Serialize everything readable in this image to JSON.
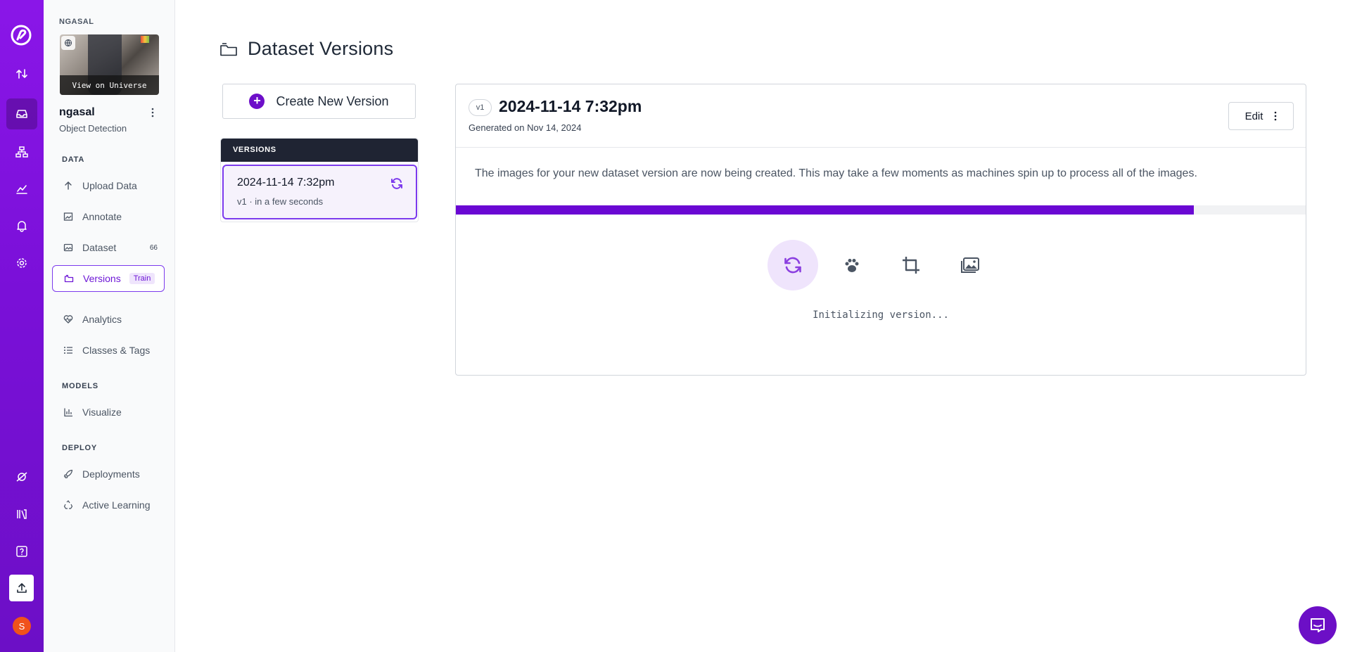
{
  "workspace": {
    "name": "NGASAL",
    "view_universe": "View on Universe"
  },
  "project": {
    "name": "ngasal",
    "type": "Object Detection"
  },
  "sidebar": {
    "sections": {
      "data": "DATA",
      "models": "MODELS",
      "deploy": "DEPLOY"
    },
    "items": [
      {
        "label": "Upload Data"
      },
      {
        "label": "Annotate"
      },
      {
        "label": "Dataset",
        "count": "66"
      },
      {
        "label": "Versions",
        "badge": "Train"
      },
      {
        "label": "Analytics"
      },
      {
        "label": "Classes & Tags"
      },
      {
        "label": "Visualize"
      },
      {
        "label": "Deployments"
      },
      {
        "label": "Active Learning"
      }
    ]
  },
  "rail": {
    "icons": [
      "roboflow-logo-icon",
      "transfer-icon",
      "inbox-icon",
      "workflows-icon",
      "chart-icon",
      "bell-icon",
      "settings-icon",
      "planet-icon",
      "books-icon",
      "help-icon",
      "upload-icon"
    ],
    "avatar_initial": "S"
  },
  "main": {
    "title": "Dataset Versions",
    "create_label": "Create New Version",
    "versions_header": "VERSIONS",
    "version_card": {
      "title": "2024-11-14 7:32pm",
      "subtitle": "v1 · in a few seconds"
    }
  },
  "detail": {
    "version_pill": "v1",
    "title": "2024-11-14 7:32pm",
    "generated": "Generated on Nov 14, 2024",
    "edit_label": "Edit",
    "message": "The images for your new dataset version are now being created. This may take a few moments as machines spin up to process all of the images.",
    "progress": 0.868,
    "status": "Initializing version...",
    "steps": [
      "refresh-icon",
      "paw-icon",
      "crop-icon",
      "images-icon"
    ]
  },
  "colors": {
    "brand": "#6c0fc6",
    "accent": "#7c3aed",
    "dark_header": "#1f2433"
  }
}
